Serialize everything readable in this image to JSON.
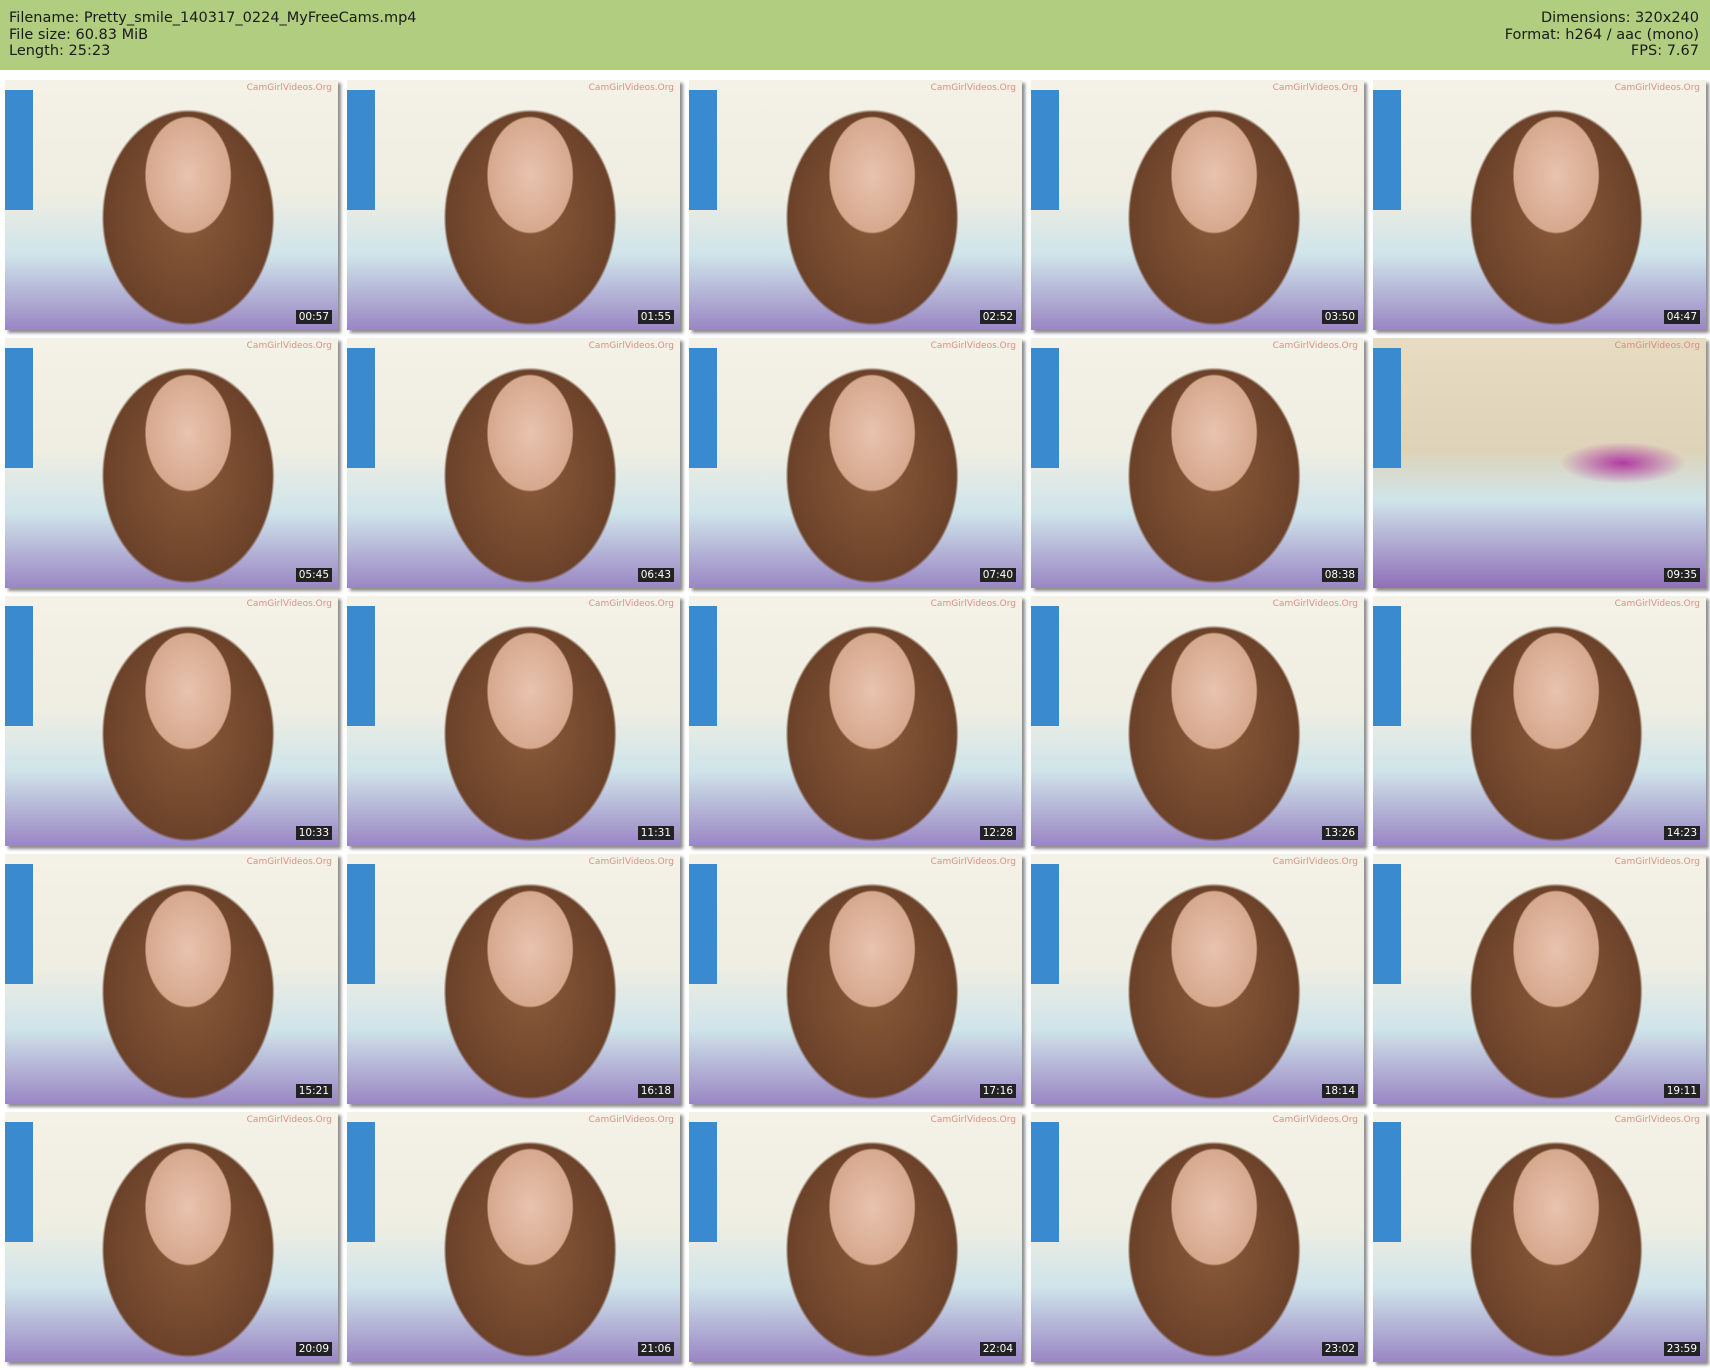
{
  "header": {
    "filename": "Filename: Pretty_smile_140317_0224_MyFreeCams.mp4",
    "filesize": "File size: 60.83 MiB",
    "length": "Length: 25:23",
    "dimensions": "Dimensions: 320x240",
    "format": "Format: h264 / aac (mono)",
    "fps": "FPS: 7.67"
  },
  "watermark": "CamGirlVideos.Org",
  "thumbnails": [
    "00:57",
    "01:55",
    "02:52",
    "03:50",
    "04:47",
    "05:45",
    "06:43",
    "07:40",
    "08:38",
    "09:35",
    "10:33",
    "11:31",
    "12:28",
    "13:26",
    "14:23",
    "15:21",
    "16:18",
    "17:16",
    "18:14",
    "19:11",
    "20:09",
    "21:06",
    "22:04",
    "23:02",
    "23:59"
  ]
}
